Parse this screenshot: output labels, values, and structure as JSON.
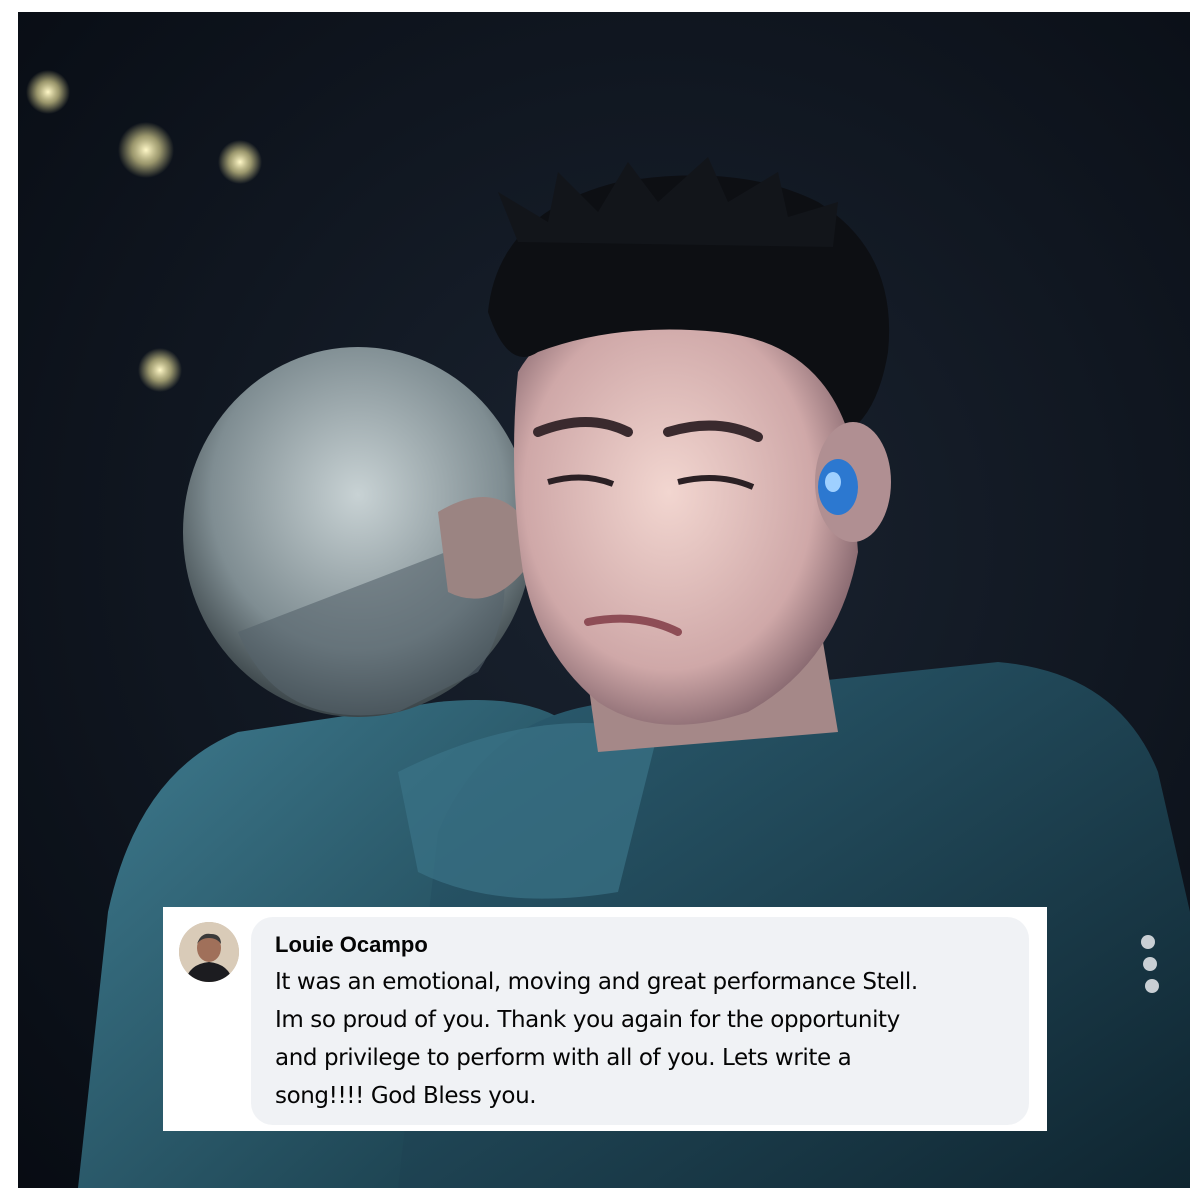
{
  "comment": {
    "author": "Louie Ocampo",
    "lines": [
      "It was an emotional, moving and great performance Stell.",
      "Im so proud of you. Thank you again for the opportunity",
      "and privilege to perform with all of you. Lets write a",
      "song!!!! God Bless you."
    ]
  },
  "photo": {
    "icon": "concert-embrace-photo"
  },
  "avatar": {
    "icon": "profile-avatar"
  },
  "colors": {
    "bubble_bg": "#f0f2f5",
    "text": "#050505",
    "jacket": "#2a5a6e",
    "night_sky": "#0a0f17"
  }
}
